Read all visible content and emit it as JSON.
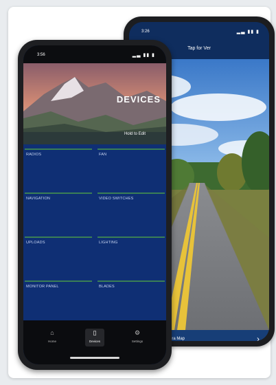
{
  "back_phone": {
    "status": {
      "time": "3:26",
      "indicators": "▂▃ ▮▮ ▮"
    },
    "header_title": "Tap for Ver",
    "bottom_bar": {
      "label": "Ingra Map",
      "chevron": "›"
    }
  },
  "front_phone": {
    "status": {
      "time": "3:56",
      "indicators": "▂▃ ▮▮ ▮"
    },
    "hero": {
      "title": "DEVICES",
      "subtitle": "Hold to Edit"
    },
    "menu": [
      {
        "label": "RADIOS"
      },
      {
        "label": "FAN"
      },
      {
        "label": "NAVIGATION"
      },
      {
        "label": "VIDEO SWITCHES"
      },
      {
        "label": "UPLOADS"
      },
      {
        "label": "LIGHTING"
      },
      {
        "label": "MONITOR PANEL"
      },
      {
        "label": "BLADES"
      }
    ],
    "nav": [
      {
        "label": "Home",
        "icon": "home-icon"
      },
      {
        "label": "Devices",
        "icon": "devices-icon"
      },
      {
        "label": "Settings",
        "icon": "settings-icon"
      }
    ]
  }
}
